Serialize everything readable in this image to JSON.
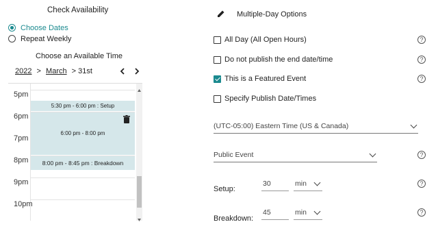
{
  "left": {
    "title": "Check Availability",
    "options": [
      {
        "label": "Choose Dates",
        "checked": true
      },
      {
        "label": "Repeat Weekly",
        "checked": false
      }
    ],
    "choose_time": "Choose an Available Time",
    "breadcrumb": {
      "year": "2022",
      "sep1": ">",
      "month": "March",
      "day": "> 31st"
    },
    "hours": [
      "5pm",
      "6pm",
      "7pm",
      "8pm",
      "9pm",
      "10pm"
    ],
    "events": [
      {
        "label": "5:30 pm - 6:00 pm : Setup"
      },
      {
        "label": "6:00 pm - 8:00 pm"
      },
      {
        "label": "8:00 pm - 8:45 pm : Breakdown"
      }
    ]
  },
  "right": {
    "multi_day": "Multiple-Day Options",
    "checkboxes": [
      {
        "label": "All Day (All Open Hours)",
        "checked": false
      },
      {
        "label": "Do not publish the end date/time",
        "checked": false
      },
      {
        "label": "This is a Featured Event",
        "checked": true
      },
      {
        "label": "Specify Publish Date/Times",
        "checked": false
      }
    ],
    "timezone": "(UTC-05:00) Eastern Time (US & Canada)",
    "visibility": "Public Event",
    "setup": {
      "label": "Setup:",
      "value": "30",
      "unit": "min"
    },
    "breakdown": {
      "label": "Breakdown:",
      "value": "45",
      "unit": "min"
    },
    "help_glyph": "?"
  },
  "colors": {
    "accent": "#1b8a8f",
    "event_bg": "#d5e7ea"
  }
}
